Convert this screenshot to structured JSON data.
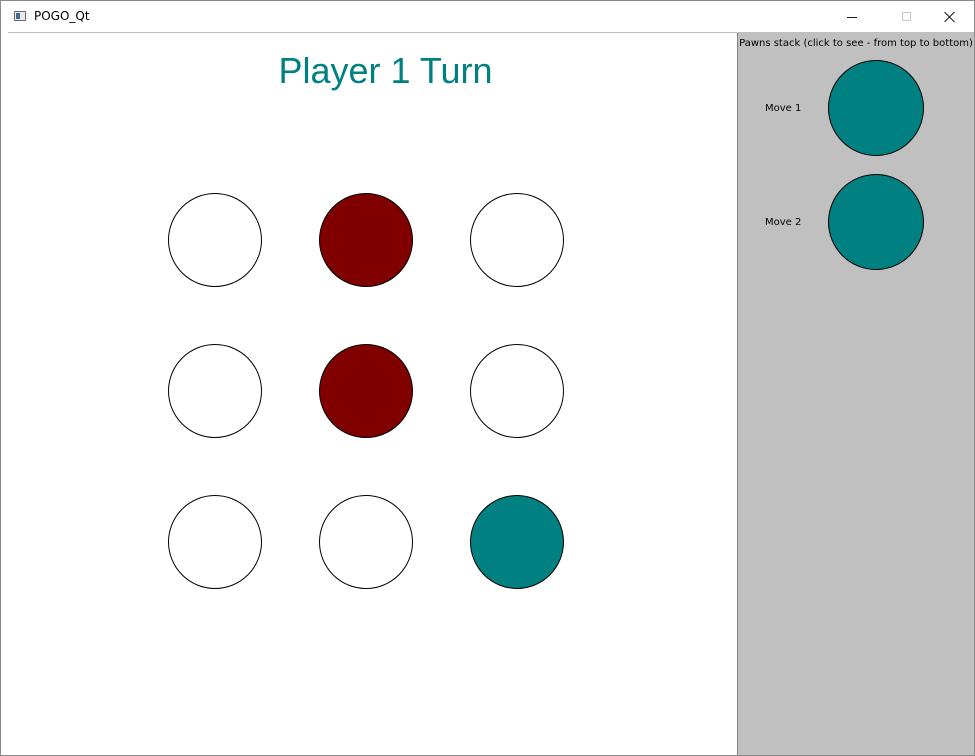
{
  "window": {
    "title": "POGO_Qt",
    "icon": "app-window-icon",
    "controls": [
      "minimize-icon",
      "maximize-icon",
      "close-icon"
    ]
  },
  "board": {
    "turn_label": "Player 1 Turn",
    "turn_color": "#008080",
    "colors": {
      "empty": "#ffffff",
      "player1": "#008080",
      "player2": "#800000"
    },
    "cells": [
      {
        "row": 1,
        "col": 1,
        "state": "empty"
      },
      {
        "row": 1,
        "col": 2,
        "state": "player2"
      },
      {
        "row": 1,
        "col": 3,
        "state": "empty"
      },
      {
        "row": 2,
        "col": 1,
        "state": "empty"
      },
      {
        "row": 2,
        "col": 2,
        "state": "player2"
      },
      {
        "row": 2,
        "col": 3,
        "state": "empty"
      },
      {
        "row": 3,
        "col": 1,
        "state": "empty"
      },
      {
        "row": 3,
        "col": 2,
        "state": "empty"
      },
      {
        "row": 3,
        "col": 3,
        "state": "player1"
      }
    ]
  },
  "stack_panel": {
    "header": "Pawns stack (click to see - from top to bottom)",
    "background": "#c0c0c0",
    "moves": [
      {
        "label": "Move 1",
        "color": "#008080"
      },
      {
        "label": "Move 2",
        "color": "#008080"
      }
    ]
  }
}
